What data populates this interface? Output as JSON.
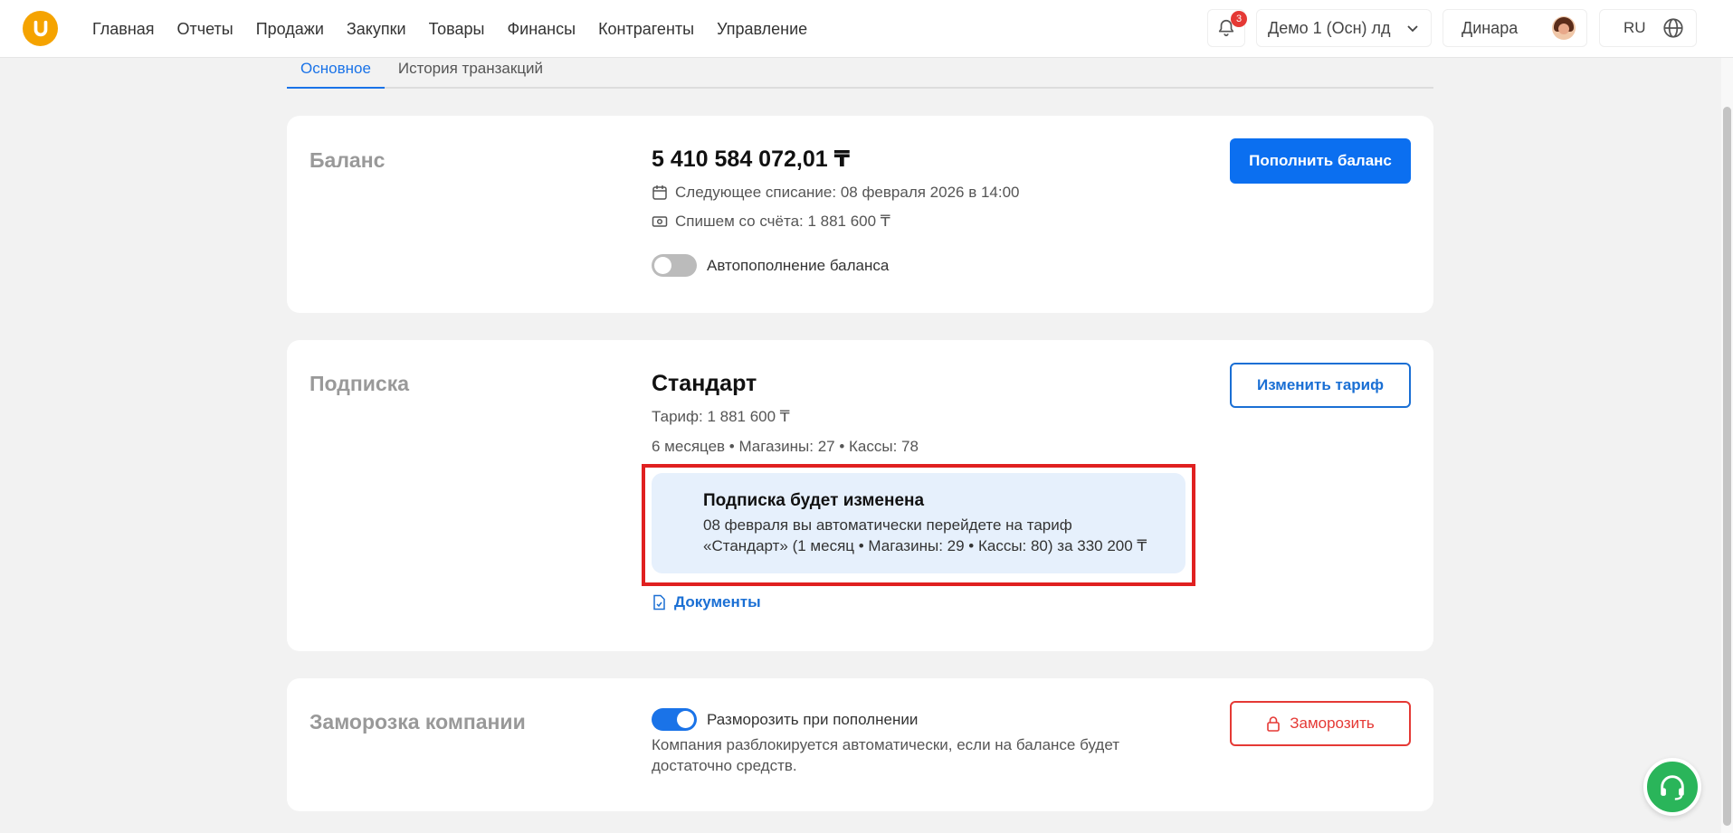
{
  "header": {
    "nav": [
      "Главная",
      "Отчеты",
      "Продажи",
      "Закупки",
      "Товары",
      "Финансы",
      "Контрагенты",
      "Управление"
    ],
    "notifications_count": "3",
    "company": "Демо 1 (Осн) лд",
    "user_name": "Динара",
    "language": "RU"
  },
  "tabs": {
    "main": "Основное",
    "history": "История транзакций"
  },
  "balance": {
    "title": "Баланс",
    "amount": "5 410 584 072,01 ₸",
    "next_charge": "Следующее списание: 08 февраля 2026 в 14:00",
    "charge_amount": "Спишем со счёта: 1 881 600 ₸",
    "autorefill_label": "Автопополнение баланса",
    "autorefill_enabled": false,
    "topup_button": "Пополнить баланс"
  },
  "subscription": {
    "title": "Подписка",
    "plan_name": "Стандарт",
    "tariff": "Тариф: 1 881 600 ₸",
    "details": "6 месяцев • Магазины: 27 • Кассы: 78",
    "change_button": "Изменить тариф",
    "notice_title": "Подписка будет изменена",
    "notice_line1": "08 февраля вы автоматически перейдете на тариф",
    "notice_line2": "«Стандарт» (1 месяц • Магазины: 29 • Кассы: 80) за 330 200 ₸",
    "documents_link": "Документы"
  },
  "freeze": {
    "title": "Заморозка компании",
    "unfreeze_label": "Разморозить при пополнении",
    "unfreeze_enabled": true,
    "description": "Компания разблокируется автоматически, если на балансе будет достаточно средств.",
    "freeze_button": "Заморозить"
  },
  "colors": {
    "accent": "#0b6ff0",
    "danger": "#e53935",
    "logo": "#f5a300",
    "support": "#2ab55a"
  }
}
